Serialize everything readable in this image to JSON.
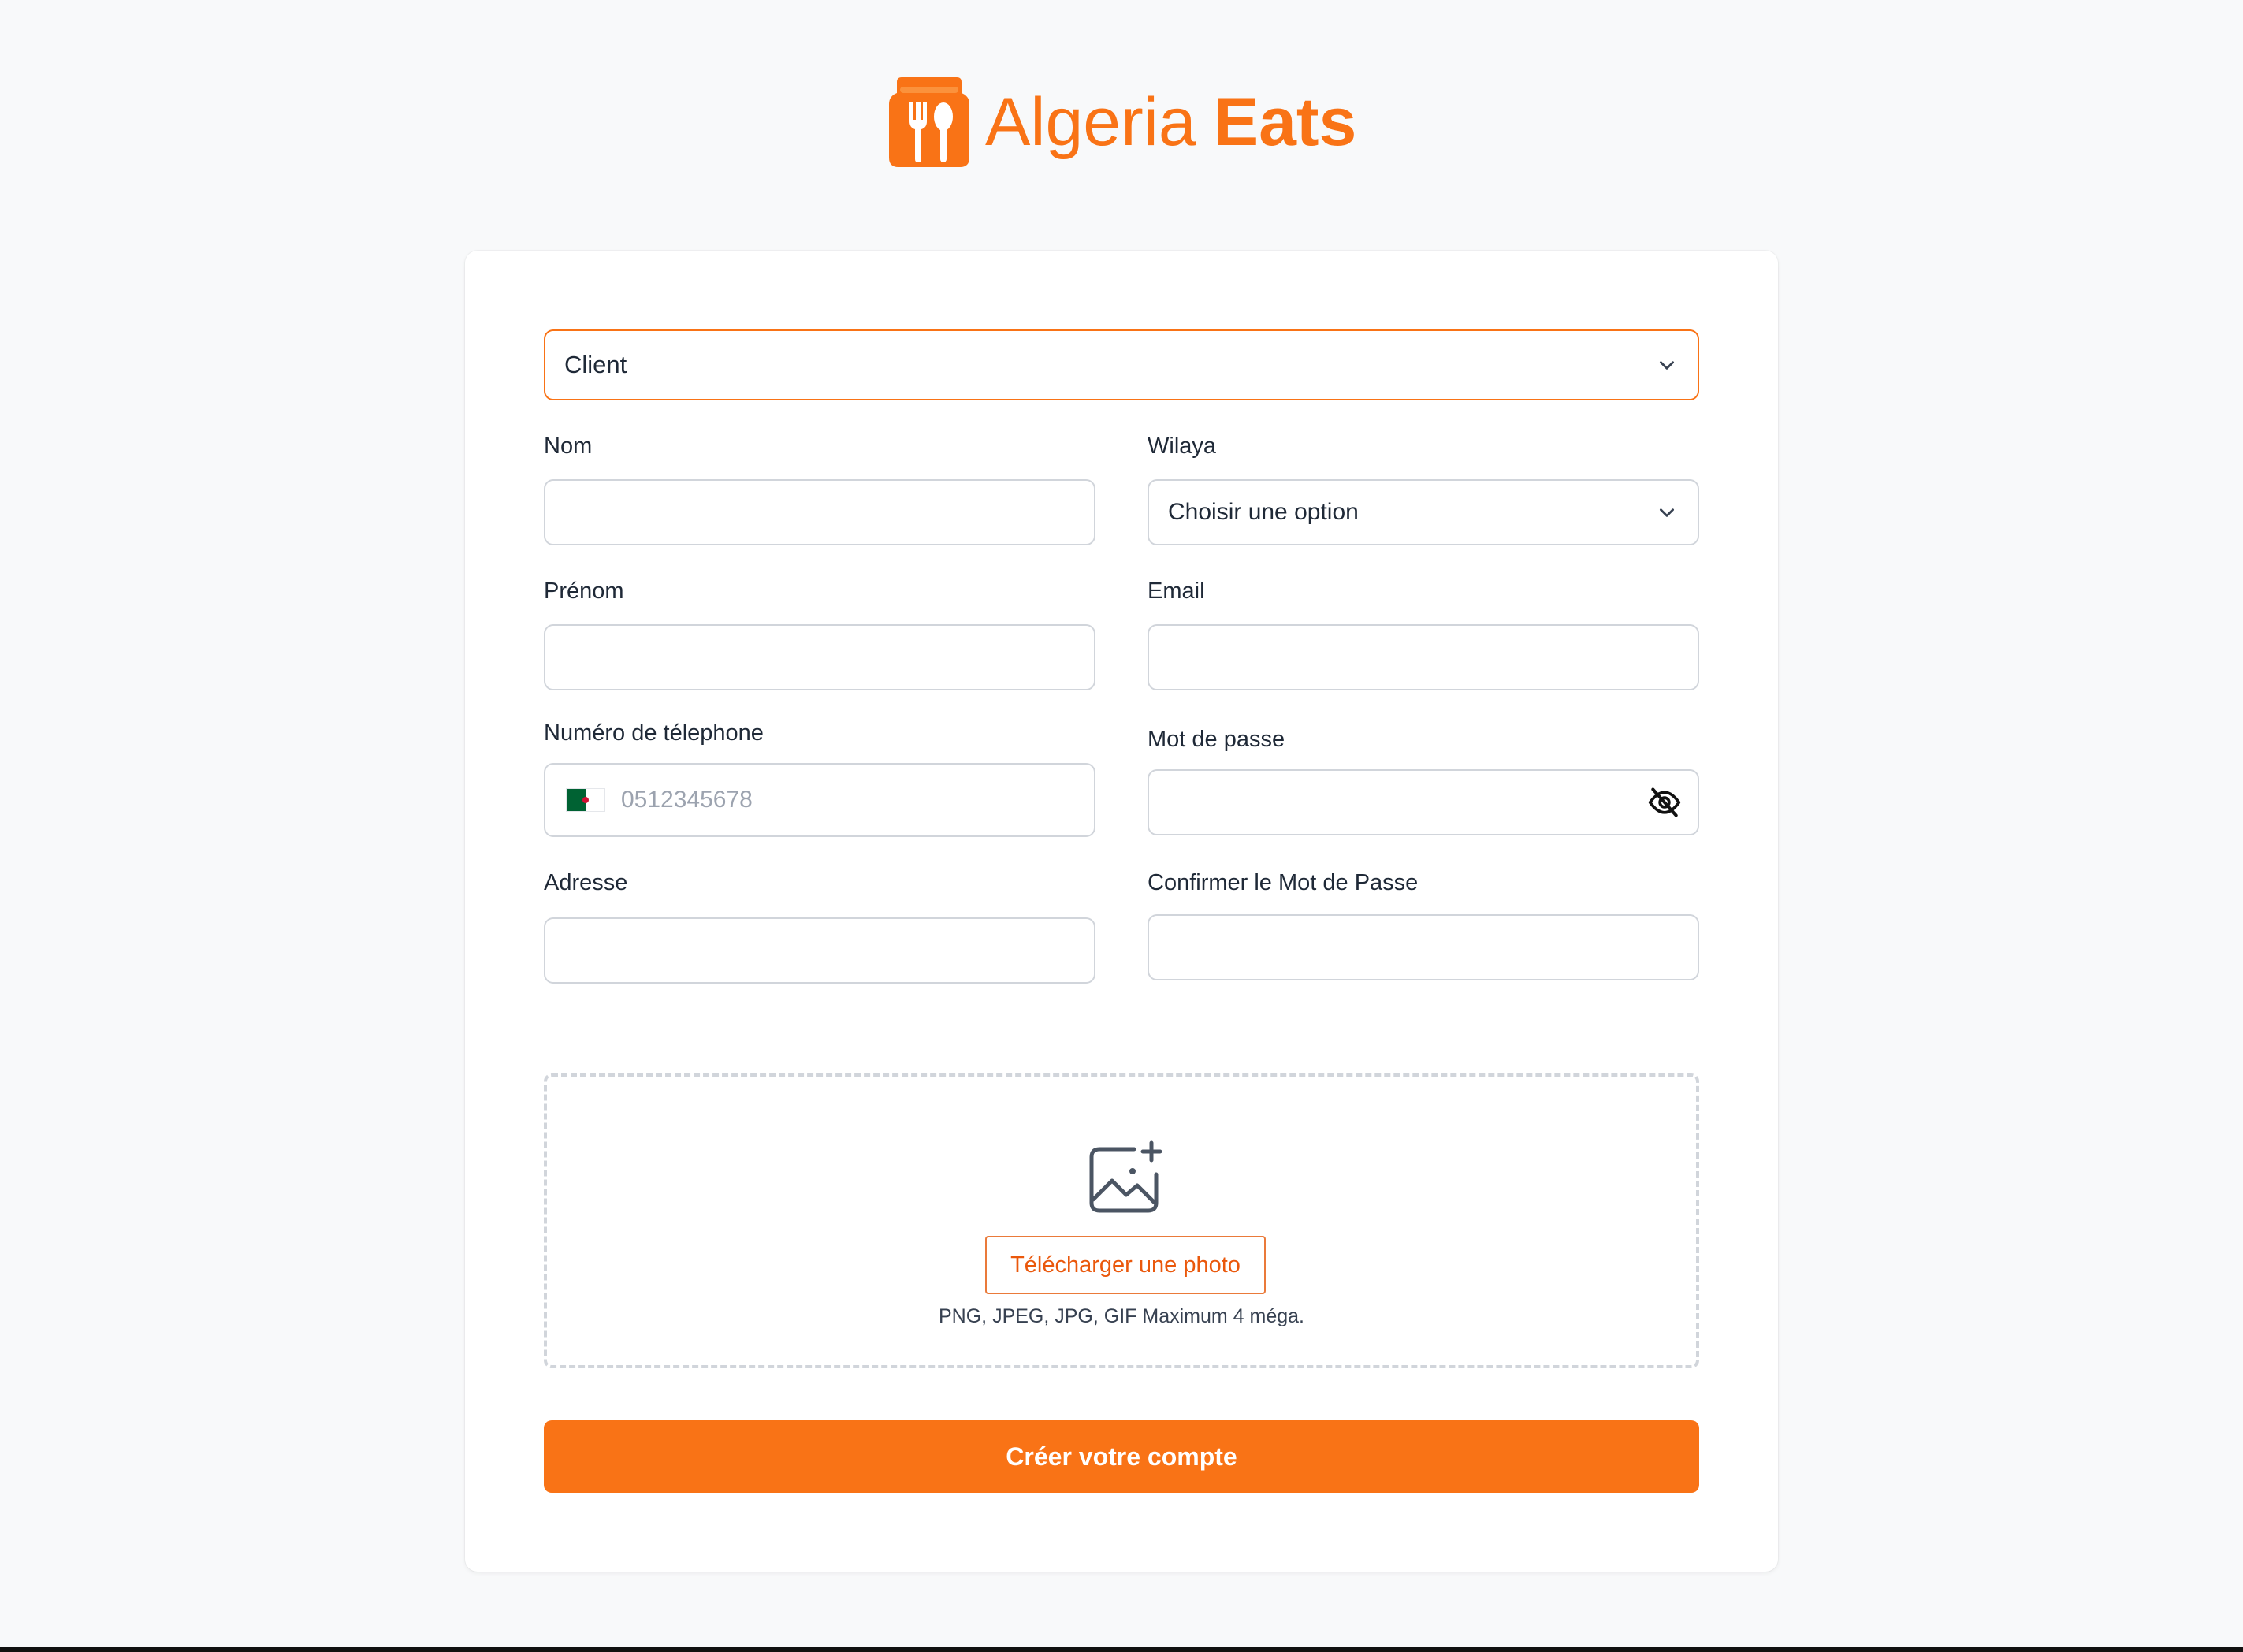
{
  "brand": {
    "name_light": "Algeria",
    "name_bold": "Eats",
    "accent_color": "#f97316",
    "logo_icon": "fork-spoon-bag-icon"
  },
  "form": {
    "role_select": {
      "value": "Client",
      "icon": "chevron-down-icon"
    },
    "nom": {
      "label": "Nom",
      "value": ""
    },
    "wilaya": {
      "label": "Wilaya",
      "value": "Choisir une option",
      "icon": "chevron-down-icon"
    },
    "prenom": {
      "label": "Prénom",
      "value": ""
    },
    "email": {
      "label": "Email",
      "value": ""
    },
    "phone": {
      "label": "Numéro de télephone",
      "placeholder": "0512345678",
      "flag": "algeria-flag"
    },
    "password": {
      "label": "Mot de passe",
      "value": "",
      "icon": "eye-off-icon"
    },
    "adresse": {
      "label": "Adresse",
      "value": ""
    },
    "confirm_password": {
      "label": "Confirmer le Mot de Passe",
      "value": ""
    },
    "upload": {
      "icon": "image-add-icon",
      "button_label": "Télécharger une photo",
      "hint": "PNG, JPEG, JPG, GIF Maximum 4 méga."
    },
    "submit_label": "Créer votre compte"
  }
}
